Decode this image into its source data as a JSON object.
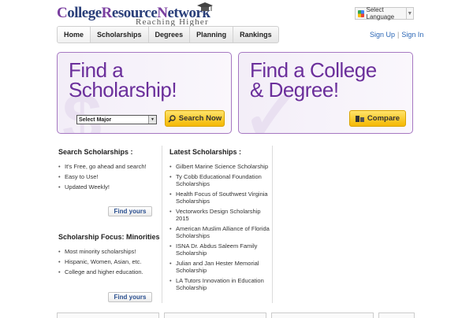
{
  "header": {
    "logo_part1_cap": "C",
    "logo_part1": "ollege",
    "logo_part2_cap": "R",
    "logo_part2": "esource",
    "logo_part3_cap": "N",
    "logo_part3": "etwork",
    "tagline": "Reaching Higher",
    "language_select": "Select Language"
  },
  "nav": {
    "items": [
      "Home",
      "Scholarships",
      "Degrees",
      "Planning",
      "Rankings"
    ]
  },
  "toplinks": {
    "signup": "Sign Up",
    "separator": "|",
    "signin": "Sign In"
  },
  "scholarship_panel": {
    "line1": "Find a",
    "line2": "Scholarship!",
    "select_value": "Select Major",
    "button": "Search Now"
  },
  "college_panel": {
    "line1": "Find a College",
    "line2": "& Degree!",
    "button": "Compare"
  },
  "search_scholarships": {
    "title": "Search Scholarships :",
    "items": [
      "It's Free, go ahead and search!",
      "Easy to Use!",
      "Updated Weekly!"
    ],
    "button": "Find yours"
  },
  "focus_minorities": {
    "title": "Scholarship Focus: Minorities",
    "items": [
      "Most minority scholarships!",
      "Hispanic, Women, Asian, etc.",
      "College and higher education."
    ],
    "button": "Find yours"
  },
  "latest": {
    "title": "Latest Scholarships :",
    "items": [
      "Gilbert Marine Science Scholarship",
      "Ty Cobb Educational Foundation Scholarships",
      "Health Focus of Southwest Virginia Scholarships",
      "Vectorworks Design Scholarship 2015",
      "American Muslim Alliance of Florida Scholarships",
      "ISNA Dr. Abdus Saleem Family Scholarship",
      "Julian and Jan Hester Memorial Scholarship",
      "LA Tutors Innovation in Education Scholarship"
    ]
  },
  "colors": {
    "brand_purple": "#6b2f9b",
    "brand_blue": "#2a3f7a",
    "button_orange": "#f5b800",
    "link_blue": "#2a66b5"
  }
}
